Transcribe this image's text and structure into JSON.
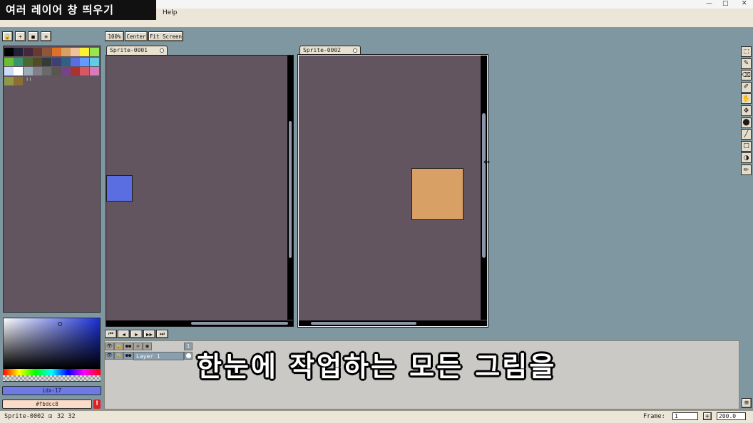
{
  "video": {
    "title": "여러 레이어 창 띄우기",
    "subtitle": "한눈에 작업하는 모든 그림을"
  },
  "menu": {
    "help": "Help"
  },
  "window_controls": {
    "minimize": "—",
    "maximize": "□",
    "close": "✕"
  },
  "palette_toolbar": [
    {
      "name": "lock",
      "glyph": "🔒"
    },
    {
      "name": "plus",
      "glyph": "+"
    },
    {
      "name": "folder",
      "glyph": "■"
    },
    {
      "name": "menu",
      "glyph": "≡"
    }
  ],
  "view_toolbar": {
    "zoom_100": "100%",
    "center": "Center",
    "fit_screen": "Fit Screen"
  },
  "palette": {
    "colors": [
      "#000000",
      "#222034",
      "#45283c",
      "#663931",
      "#8f563b",
      "#df7126",
      "#d9a066",
      "#eec39a",
      "#fbf236",
      "#99e550",
      "#6abe30",
      "#37946e",
      "#4b692f",
      "#524b24",
      "#323c39",
      "#3f3f74",
      "#306082",
      "#5b6ee1",
      "#639bff",
      "#5fcde4",
      "#cbdbfc",
      "#ffffff",
      "#9badb7",
      "#847e87",
      "#696a6a",
      "#595652",
      "#76428a",
      "#ac3232",
      "#d95763",
      "#d77bba",
      "#8f974a",
      "#8a6f30"
    ],
    "count_marker": "!!"
  },
  "colors": {
    "foreground_label": "idx-17",
    "background_label": "#fbdcc8",
    "warning": "!"
  },
  "sprites": [
    {
      "tab": "Sprite-0001",
      "rect_color": "#5b6ee1"
    },
    {
      "tab": "Sprite-0002",
      "rect_color": "#d9a066"
    }
  ],
  "timeline": {
    "controls": [
      "⏮",
      "◀",
      "▶",
      "▶▶",
      "⏭"
    ],
    "header_icons": [
      "👁",
      "🔒",
      "●●",
      "✣",
      "▣"
    ],
    "frame_number": "1",
    "layer": {
      "name": "Layer 1",
      "eye": "👁",
      "lock": "🔓",
      "link": "●●"
    }
  },
  "tools": [
    "⬚",
    "✎",
    "⌫",
    "✐",
    "✋",
    "✥",
    "⬤",
    "╱",
    "□",
    "◑",
    "✏"
  ],
  "status": {
    "sprite_name": "Sprite-0002",
    "size": "32 32",
    "frame_label": "Frame:",
    "frame_value": "1",
    "add_frame": "+",
    "zoom_value": "200.0",
    "expand_icon": "⊞"
  }
}
